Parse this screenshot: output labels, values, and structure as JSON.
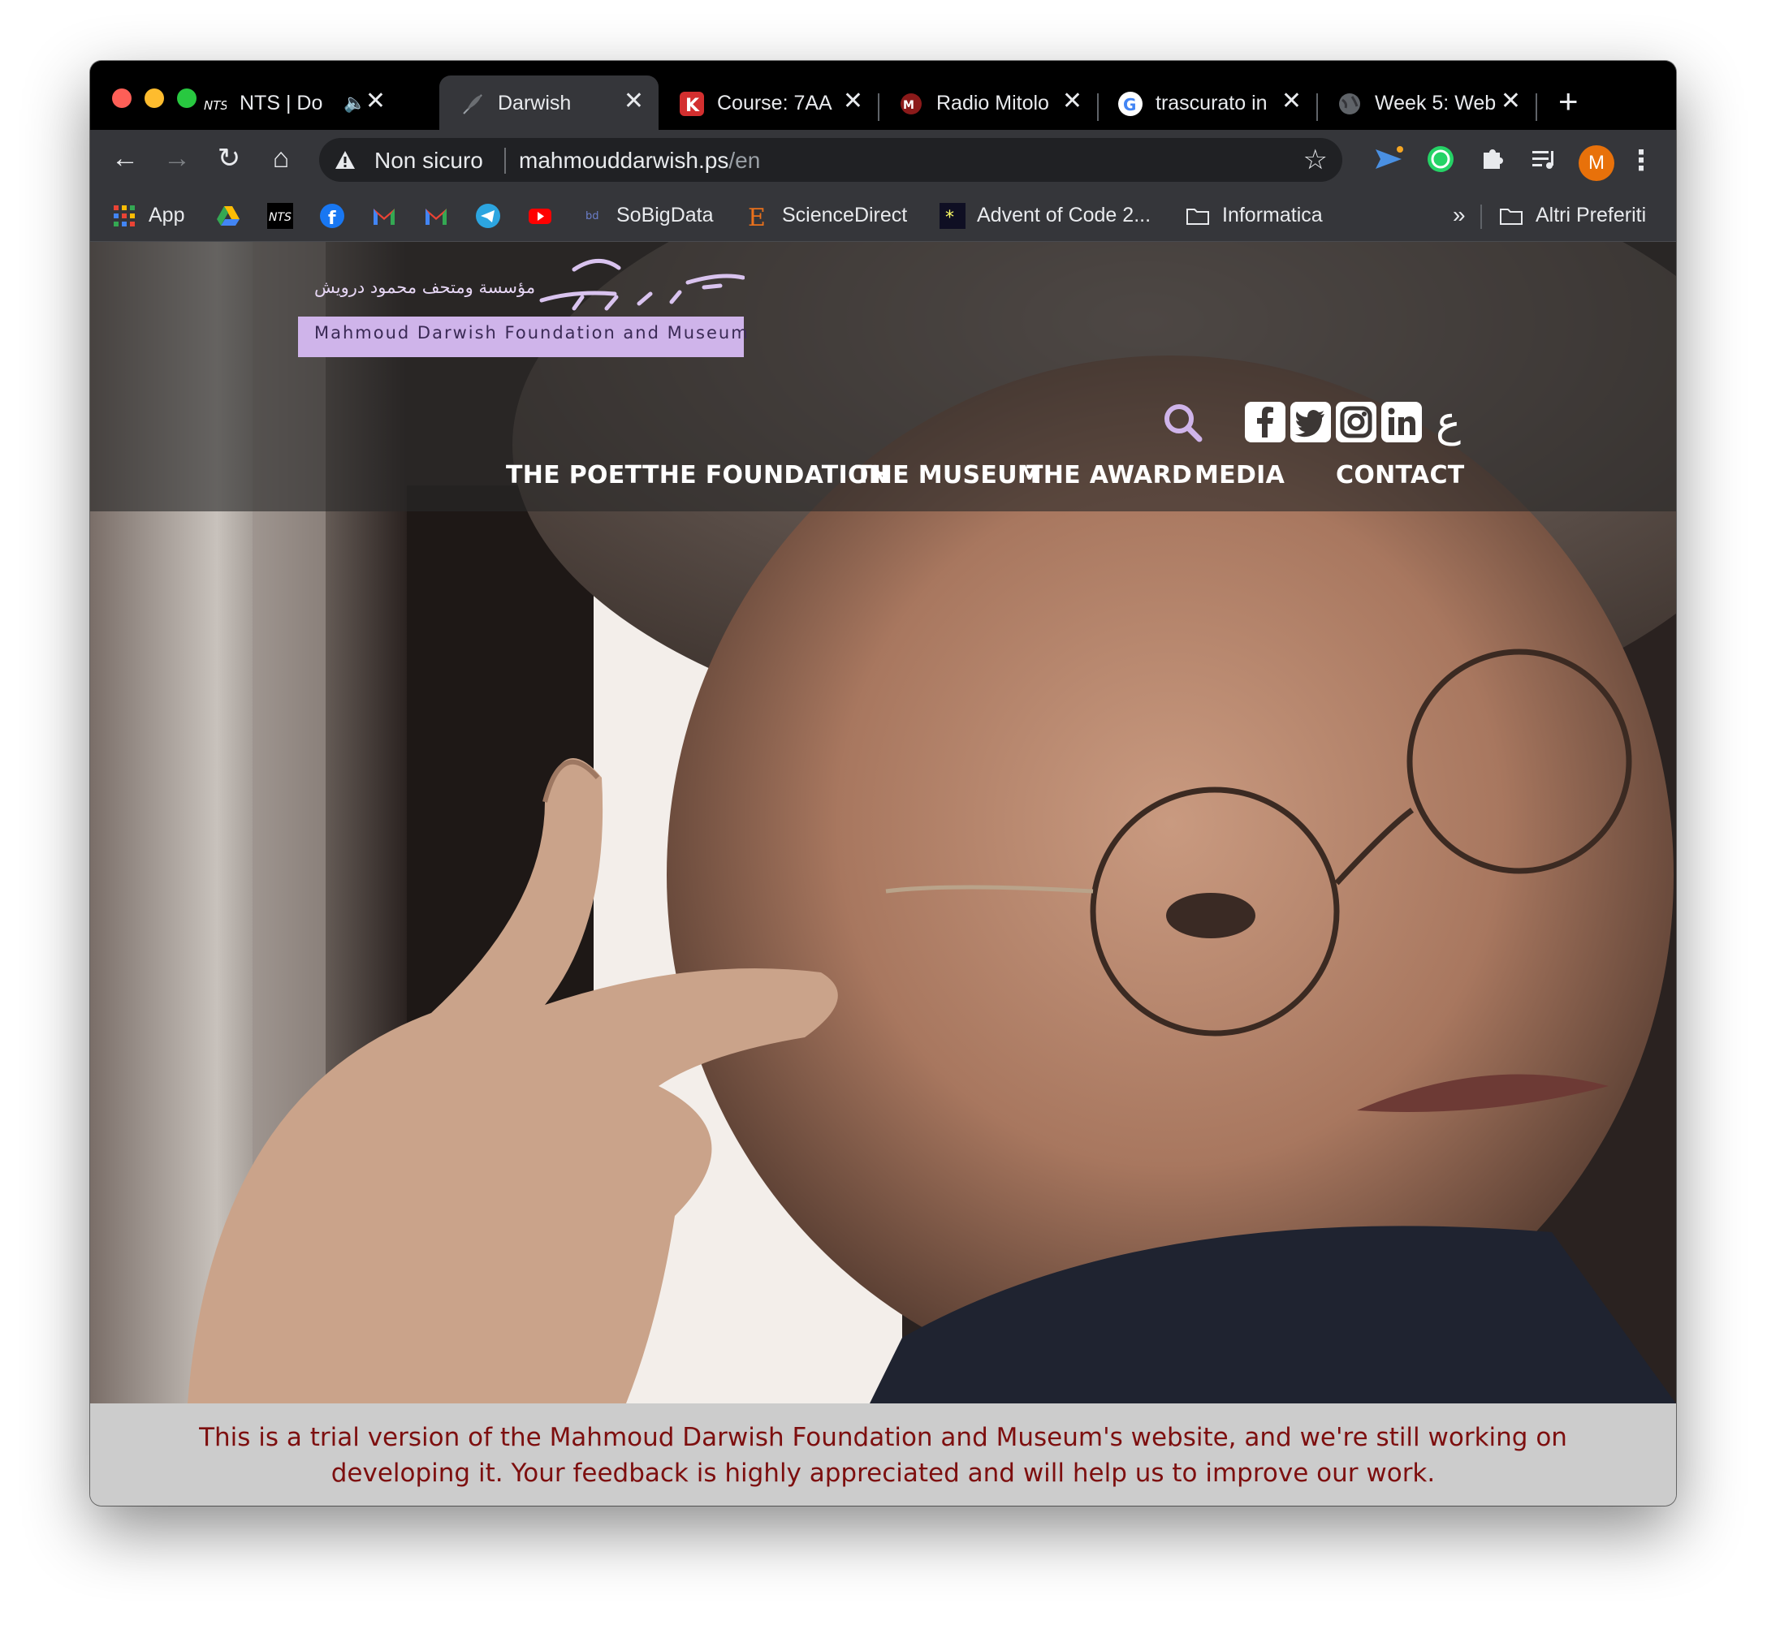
{
  "browser": {
    "tabs": [
      {
        "title": "NTS | Do",
        "favicon": "nts-icon",
        "audio": true,
        "active": false
      },
      {
        "title": "Darwish",
        "favicon": "feather-icon",
        "audio": false,
        "active": true
      },
      {
        "title": "Course: 7AA",
        "favicon": "k-icon",
        "audio": false,
        "active": false
      },
      {
        "title": "Radio Mitolo",
        "favicon": "radio-icon",
        "audio": false,
        "active": false
      },
      {
        "title": "trascurato in",
        "favicon": "google-icon",
        "audio": false,
        "active": false
      },
      {
        "title": "Week 5: Web",
        "favicon": "globe-icon",
        "audio": false,
        "active": false
      }
    ],
    "address": {
      "security": "Non sicuro",
      "host": "mahmouddarwish.ps",
      "path": "/en"
    },
    "profile_initial": "M",
    "bookmarks": [
      {
        "label": "App",
        "icon": "apps-grid-icon"
      },
      {
        "label": "",
        "icon": "google-drive-icon"
      },
      {
        "label": "",
        "icon": "nts-icon"
      },
      {
        "label": "",
        "icon": "facebook-icon"
      },
      {
        "label": "",
        "icon": "gmail-icon"
      },
      {
        "label": "",
        "icon": "gmail-icon"
      },
      {
        "label": "",
        "icon": "telegram-icon"
      },
      {
        "label": "",
        "icon": "youtube-icon"
      },
      {
        "label": "SoBigData",
        "icon": "sobigdata-icon"
      },
      {
        "label": "ScienceDirect",
        "icon": "elsevier-icon"
      },
      {
        "label": "Advent of Code 2...",
        "icon": "star-icon"
      },
      {
        "label": "Informatica",
        "icon": "folder-icon"
      }
    ],
    "bookmarks_overflow": "»",
    "other_bookmarks": "Altri Preferiti"
  },
  "site": {
    "logo_ar": "مؤسسة ومتحف محمود درويش",
    "logo_en": "Mahmoud Darwish Foundation and Museum",
    "lang_toggle": "ع",
    "nav": [
      "THE POET",
      "THE FOUNDATION",
      "THE MUSEUM",
      "THE AWARD",
      "MEDIA",
      "CONTACT"
    ],
    "notice": "This is a trial version of the Mahmoud Darwish Foundation and Museum's website, and we're still working on developing it. Your feedback is highly appreciated and will help us to improve our work."
  },
  "colors": {
    "accent": "#cfb4ea",
    "notice_text": "#7d0f0f",
    "notice_bg": "#cccccc"
  }
}
